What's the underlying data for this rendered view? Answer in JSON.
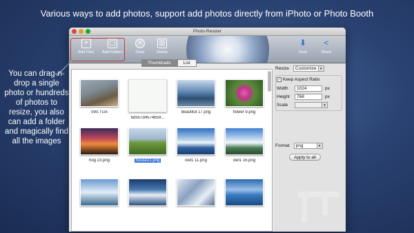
{
  "headline": "Various ways to add photos, support add photos directly from iPhoto or Photo Booth",
  "side_note": "You can drag-n-drop a single photo or hundreds of photos to resize, you also can add a folder and magically find all the images",
  "window": {
    "title": "Photo-Resizer"
  },
  "toolbar": {
    "add_files": "Add Files",
    "add_folders": "Add Folders",
    "clear": "Clear",
    "delete": "Delete",
    "save": "Save",
    "share": "Share"
  },
  "view_tabs": {
    "thumbnails": "Thumbnails",
    "list": "List"
  },
  "thumbnails": [
    {
      "name": "090.TGA",
      "style": "beach"
    },
    {
      "name": "6d557d4574b59...",
      "style": "toy"
    },
    {
      "name": "beautiful 17.png",
      "style": "lake"
    },
    {
      "name": "flower 9.png",
      "style": "flower"
    },
    {
      "name": "hog 23.png",
      "style": "pier"
    },
    {
      "name": "house21.png",
      "style": "field",
      "selected": true
    },
    {
      "name": "owl1 11.png",
      "style": "mount1"
    },
    {
      "name": "owl1 16.png",
      "style": "mount2"
    },
    {
      "name": "",
      "style": "mount3"
    },
    {
      "name": "",
      "style": "mount4"
    },
    {
      "name": "",
      "style": "snow"
    },
    {
      "name": "",
      "style": "sea"
    }
  ],
  "settings": {
    "resize_label": "Resize",
    "resize_value": "Customize",
    "keep_aspect_label": "Keep Aspect Ratio",
    "keep_aspect_checked": true,
    "width_label": "Width",
    "width_value": "1024",
    "width_unit": "px",
    "height_label": "Height",
    "height_value": "768",
    "height_unit": "px",
    "scale_label": "Scale",
    "scale_value": "",
    "format_label": "Format",
    "format_value": "png",
    "apply_label": "Apply to all"
  },
  "colors": {
    "highlight_red": "#c0392b",
    "selection_blue": "#3875d7",
    "accent_blue": "#2b6fd6"
  }
}
